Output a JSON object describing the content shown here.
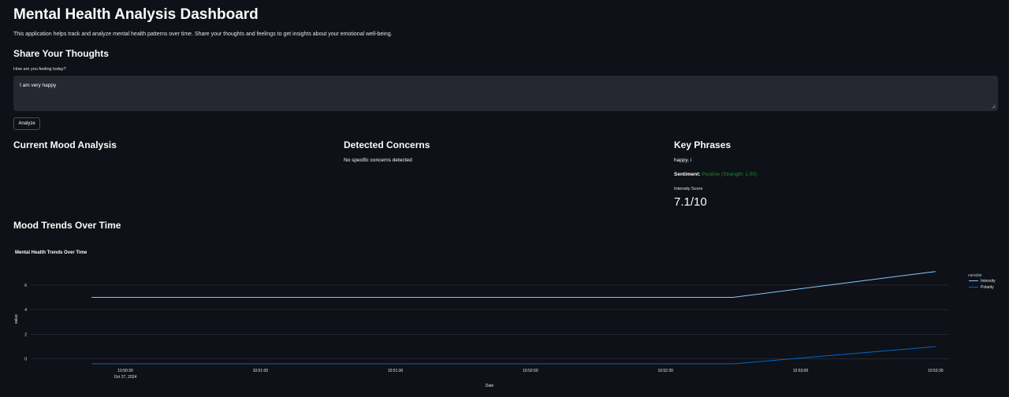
{
  "header": {
    "title": "Mental Health Analysis Dashboard",
    "description": "This application helps track and analyze mental health patterns over time. Share your thoughts and feelings to get insights about your emotional well-being."
  },
  "input_section": {
    "heading": "Share Your Thoughts",
    "field_label": "How are you feeling today?",
    "field_value": "I am very happy",
    "analyze_label": "Analyze"
  },
  "mood": {
    "heading": "Current Mood Analysis"
  },
  "concerns": {
    "heading": "Detected Concerns",
    "text": "No specific concerns detected"
  },
  "phrases": {
    "heading": "Key Phrases",
    "text": "happy, i",
    "sentiment_label": "Sentiment:",
    "sentiment_value": "Positive (Strength: 1.00)",
    "sentiment_color": "#1c8a2e",
    "metric_label": "Intensity Score",
    "metric_value": "7.1/10"
  },
  "trends": {
    "heading": "Mood Trends Over Time"
  },
  "chart_data": {
    "type": "line",
    "title": "Mental Health Trends Over Time",
    "xlabel": "Date",
    "ylabel": "value",
    "x_ticks": [
      "10:50:30",
      "10:51:00",
      "10:51:30",
      "10:52:00",
      "10:52:30",
      "10:53:00",
      "10:53:30"
    ],
    "x_tick_sub": [
      "Oct 27, 2024",
      "",
      "",
      "",
      "",
      "",
      ""
    ],
    "y_ticks": [
      0,
      2,
      4,
      6
    ],
    "ylim": [
      -0.6,
      7.4
    ],
    "grid": true,
    "legend_title": "variable",
    "legend_position": "right",
    "x_seconds": [
      0,
      1,
      2,
      3,
      4,
      5,
      6,
      7,
      8,
      9,
      10,
      11,
      12,
      13,
      14,
      15,
      16,
      17,
      18,
      19,
      20,
      21,
      22,
      23,
      24
    ],
    "series": [
      {
        "name": "Intensity",
        "color": "#83c9ff",
        "values_x_ticks_index": [
          -0.25,
          4.5,
          6.0
        ],
        "values": [
          5.0,
          5.0,
          7.1
        ]
      },
      {
        "name": "Polarity",
        "color": "#0068c9",
        "values_x_ticks_index": [
          -0.25,
          4.5,
          6.0
        ],
        "values": [
          -0.4,
          -0.4,
          1.0
        ]
      }
    ]
  }
}
